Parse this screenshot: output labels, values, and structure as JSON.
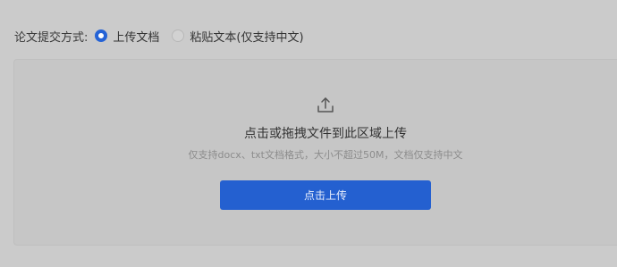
{
  "submission": {
    "label": "论文提交方式:",
    "options": [
      {
        "label": "上传文档",
        "selected": true
      },
      {
        "label": "粘贴文本(仅支持中文)",
        "selected": false
      }
    ]
  },
  "upload": {
    "icon": "upload-icon",
    "title": "点击或拖拽文件到此区域上传",
    "hint": "仅支持docx、txt文档格式，大小不超过50M，文档仅支持中文",
    "button_label": "点击上传"
  },
  "colors": {
    "accent": "#2460d0",
    "background": "#cbcbcb"
  }
}
